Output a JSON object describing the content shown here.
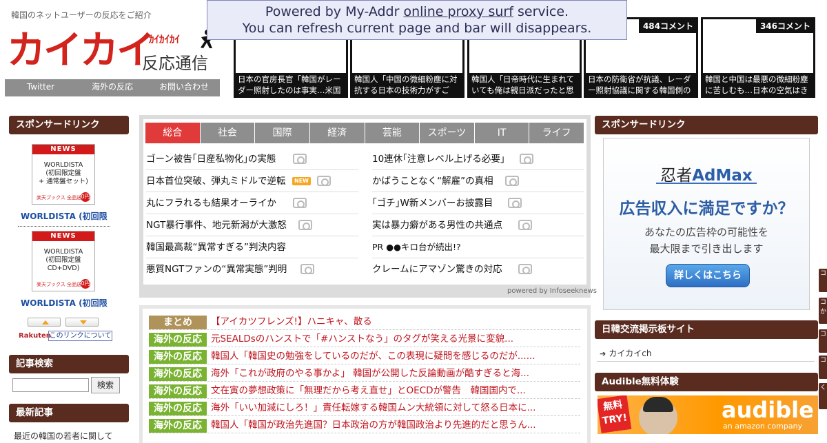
{
  "header": {
    "tagline": "韓国のネットユーザーの反応をご紹介",
    "logo_main": "カイカイ",
    "logo_kana": "ｶｲｶｲｶｲ",
    "logo_sub": "反応通信",
    "nav": [
      "Twitter",
      "海外の反応",
      "お問い合わせ"
    ]
  },
  "proxy_banner": {
    "line1_before": "Powered by My-Addr ",
    "line1_link": "online proxy surf",
    "line1_after": " service.",
    "line2": "You can refresh current page and bar will disappears."
  },
  "thumbs": [
    {
      "comments": "",
      "caption": "日本の官房長官「韓国がレーダー照射したのは事実…米国"
    },
    {
      "comments": "",
      "caption": "韓国人「中国の微細粉塵に対抗する日本の技術力がすご"
    },
    {
      "comments": "",
      "caption": "韓国人「日帝時代に生まれていても俺は親日派だったと思"
    },
    {
      "comments": "484コメント",
      "caption": "日本の防衛省が抗議、レーダー照射協議に関する韓国側の"
    },
    {
      "comments": "346コメント",
      "caption": "韓国と中国は最悪の微細粉塵に苦しむも…日本の空気はき"
    }
  ],
  "left_sidebar": {
    "sponsor_heading": "スポンサードリンク",
    "products": [
      {
        "badge": "NEWS",
        "lines": [
          "WORLDISTA",
          "(初回限定盤",
          "+ 通常盤セット)"
        ],
        "shop": "楽天ブックス 全品送料",
        "zero": "0円",
        "link": "WORLDISTA (初回限"
      },
      {
        "badge": "NEWS",
        "lines": [
          "WORLDISTA",
          "(初回限定盤",
          "CD+DVD)"
        ],
        "shop": "楽天ブックス 全品送料",
        "zero": "0円",
        "link": "WORLDISTA (初回限"
      }
    ],
    "rakuten": "Rakuten",
    "about_link": "このリンクについて",
    "search_heading": "記事検索",
    "search_button": "検索",
    "latest_heading": "最新記事",
    "latest_item": "最近の韓国の若者に関して"
  },
  "news_box": {
    "tabs": [
      "総合",
      "社会",
      "国際",
      "経済",
      "芸能",
      "スポーツ",
      "IT",
      "ライフ"
    ],
    "left_items": [
      "ゴーン被告｢日産私物化｣の実態",
      "日本首位突破、弾丸ミドルで逆転",
      "丸にフラれるも結果オーライか",
      "NGT暴行事件、地元新潟が大激怒",
      "韓国最高裁“異常すぎる”判決内容",
      "悪質NGTファンの“異常実態”判明"
    ],
    "right_items": [
      "10連休｢注意レベル上げる必要｣",
      "かばうことなく“解雇”の真相",
      "｢ゴチ｣W新メンバーお披露目",
      "実は暴力癖がある男性の共通点",
      "PR ●●キロ台が続出!?",
      "クレームにアマゾン驚きの対応"
    ],
    "new_badge": "NEW",
    "powered": "powered by Infoseeknews"
  },
  "matome": [
    {
      "tag": "まとめ",
      "text": "【アイカツフレンズ!】ハニキャ、散る"
    },
    {
      "tag": "海外の反応",
      "text": "元SEALDsのハンストで「#ハンストなう」のタグが笑える光景に変貌..."
    },
    {
      "tag": "海外の反応",
      "text": "韓国人「韓国史の勉強をしているのだが、この表現に疑問を感じるのだが......"
    },
    {
      "tag": "海外の反応",
      "text": "海外「これが政府のやる事かよ」 韓国が公開した反論動画が酷すぎると海..."
    },
    {
      "tag": "海外の反応",
      "text": "文在寅の夢想政策に「無理だから考え直せ」とOECDが警告　韓国国内で..."
    },
    {
      "tag": "海外の反応",
      "text": "海外「いい加減にしろ！」責任転嫁する韓国ムン大統領に対して怒る日本に..."
    },
    {
      "tag": "海外の反応",
      "text": "韓国人「韓国が政治先進国？日本政治の方が韓国政治より先進的だと思うん..."
    }
  ],
  "right_sidebar": {
    "sponsor_heading": "スポンサードリンク",
    "admax_logo_a": "忍者",
    "admax_logo_b": "AdMax",
    "admax_head": "広告収入に満足ですか？",
    "admax_body1": "あなたの広告枠の可能性を",
    "admax_body2": "最大限まで引き出します",
    "admax_button": "詳しくはこちら",
    "bbs_heading": "日韓交流掲示板サイト",
    "bbs_item": "カイカイch",
    "audible_heading": "Audible無料体験",
    "audible_free": "無料TRY!",
    "audible_word": "audible",
    "audible_sub": "an amazon company"
  },
  "edge_tabs": [
    "コ",
    "コか",
    "コ",
    "コ",
    "く"
  ]
}
